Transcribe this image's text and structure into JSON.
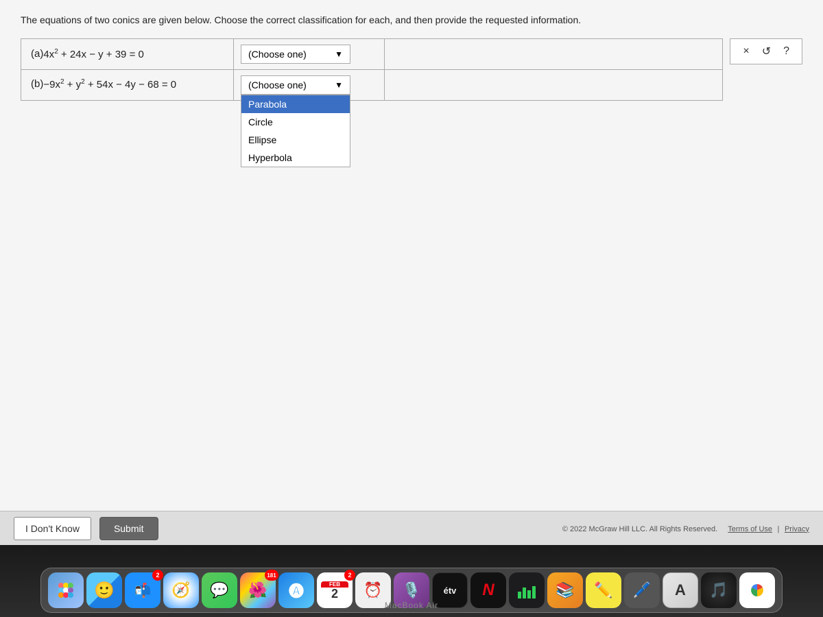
{
  "page": {
    "instructions": "The equations of two conics are given below. Choose the correct classification for each, and then provide the requested information.",
    "copyright": "© 2022 McGraw Hill LLC. All Rights Reserved.",
    "terms_link": "Terms of Use",
    "privacy_link": "Privacy"
  },
  "questions": {
    "a": {
      "part": "(a)",
      "equation": "4x² + 24x − y + 39 = 0",
      "dropdown_label": "(Choose one)"
    },
    "b": {
      "part": "(b)",
      "equation": "−9x² + y² + 54x − 4y − 68 = 0",
      "dropdown_label": "(Choose one)"
    }
  },
  "dropdown_b": {
    "options": [
      "Parabola",
      "Circle",
      "Ellipse",
      "Hyperbola"
    ],
    "selected": "Parabola"
  },
  "controls": {
    "close": "×",
    "undo": "↺",
    "help": "?"
  },
  "buttons": {
    "dont_know": "I Don't Know",
    "submit": "Submit"
  },
  "dock": {
    "macbook_label": "MacBook Air",
    "items": [
      {
        "name": "launchpad",
        "color": "#5b9bd5",
        "badge": null
      },
      {
        "name": "finder",
        "color": "#5ac8fa",
        "badge": null
      },
      {
        "name": "mail",
        "color": "#4488cc",
        "badge": null
      },
      {
        "name": "safari",
        "color": "#3399ff",
        "badge": null
      },
      {
        "name": "messages",
        "color": "#5ac85a",
        "badge": null
      },
      {
        "name": "photos",
        "color": "#ff6b6b",
        "badge": "181"
      },
      {
        "name": "music",
        "color": "#ff3b30",
        "badge": null
      },
      {
        "name": "calendar",
        "color": "#ff6b35",
        "label": "FEB\n2",
        "badge": "2"
      },
      {
        "name": "reminders",
        "color": "#ddd",
        "badge": null
      },
      {
        "name": "podcasts",
        "color": "#9b59b6",
        "badge": null
      },
      {
        "name": "apple-tv",
        "color": "#111",
        "badge": null
      },
      {
        "name": "netflix",
        "color": "#e50914",
        "badge": null
      },
      {
        "name": "stocks",
        "color": "#1c1c1e",
        "badge": null
      },
      {
        "name": "books",
        "color": "#f5a623",
        "badge": null
      },
      {
        "name": "notes",
        "color": "#f0e68c",
        "badge": null
      },
      {
        "name": "scribble",
        "color": "#555",
        "badge": null
      },
      {
        "name": "font-book",
        "color": "#e8e8e8",
        "badge": null
      },
      {
        "name": "music-app",
        "color": "#111",
        "badge": null
      },
      {
        "name": "chrome",
        "color": "#4285f4",
        "badge": null
      }
    ]
  }
}
